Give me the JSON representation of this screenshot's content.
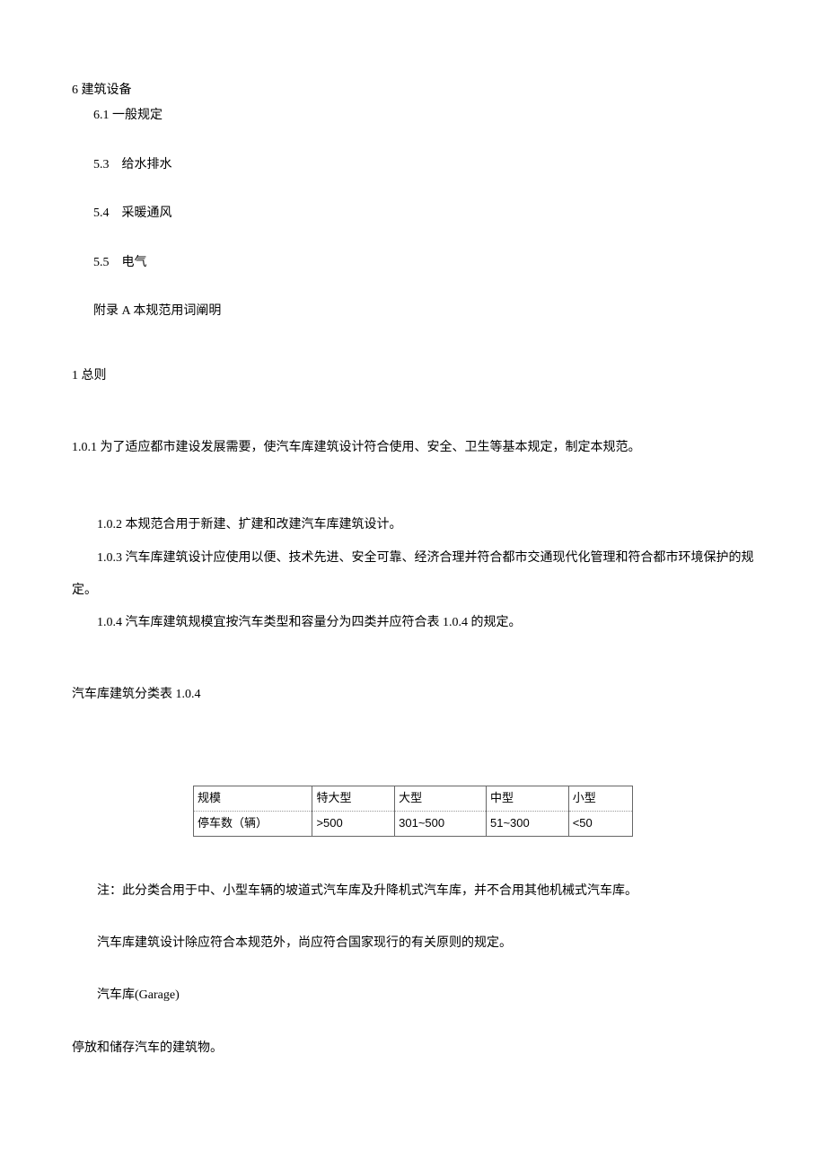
{
  "toc": {
    "s6": "6 建筑设备",
    "s6_1": "6.1 一般规定",
    "s5_3": "5.3　给水排水",
    "s5_4": "5.4　采暖通风",
    "s5_5": "5.5　电气",
    "appendix": "附录 A 本规范用词阐明"
  },
  "section1": {
    "title": "1 总则",
    "p1": "1.0.1 为了适应都市建设发展需要，使汽车库建筑设计符合使用、安全、卫生等基本规定，制定本规范。",
    "p2": "1.0.2 本规范合用于新建、扩建和改建汽车库建筑设计。",
    "p3": "1.0.3 汽车库建筑设计应使用以便、技术先进、安全可靠、经济合理并符合都市交通现代化管理和符合都市环境保护的规定。",
    "p4": "1.0.4 汽车库建筑规模宜按汽车类型和容量分为四类并应符合表 1.0.4 的规定。"
  },
  "table": {
    "title": "汽车库建筑分类表 1.0.4",
    "header": {
      "c0": "规模",
      "c1": "特大型",
      "c2": "大型",
      "c3": "中型",
      "c4": "小型"
    },
    "row": {
      "c0": "停车数（辆）",
      "c1": ">500",
      "c2": "301~500",
      "c3": "51~300",
      "c4": "<50"
    }
  },
  "notes": {
    "n1": "注：此分类合用于中、小型车辆的坡道式汽车库及升降机式汽车库，并不合用其他机械式汽车库。",
    "n2": "汽车库建筑设计除应符合本规范外，尚应符合国家现行的有关原则的规定。",
    "n3": "汽车库(Garage)",
    "n4": "停放和储存汽车的建筑物。"
  }
}
